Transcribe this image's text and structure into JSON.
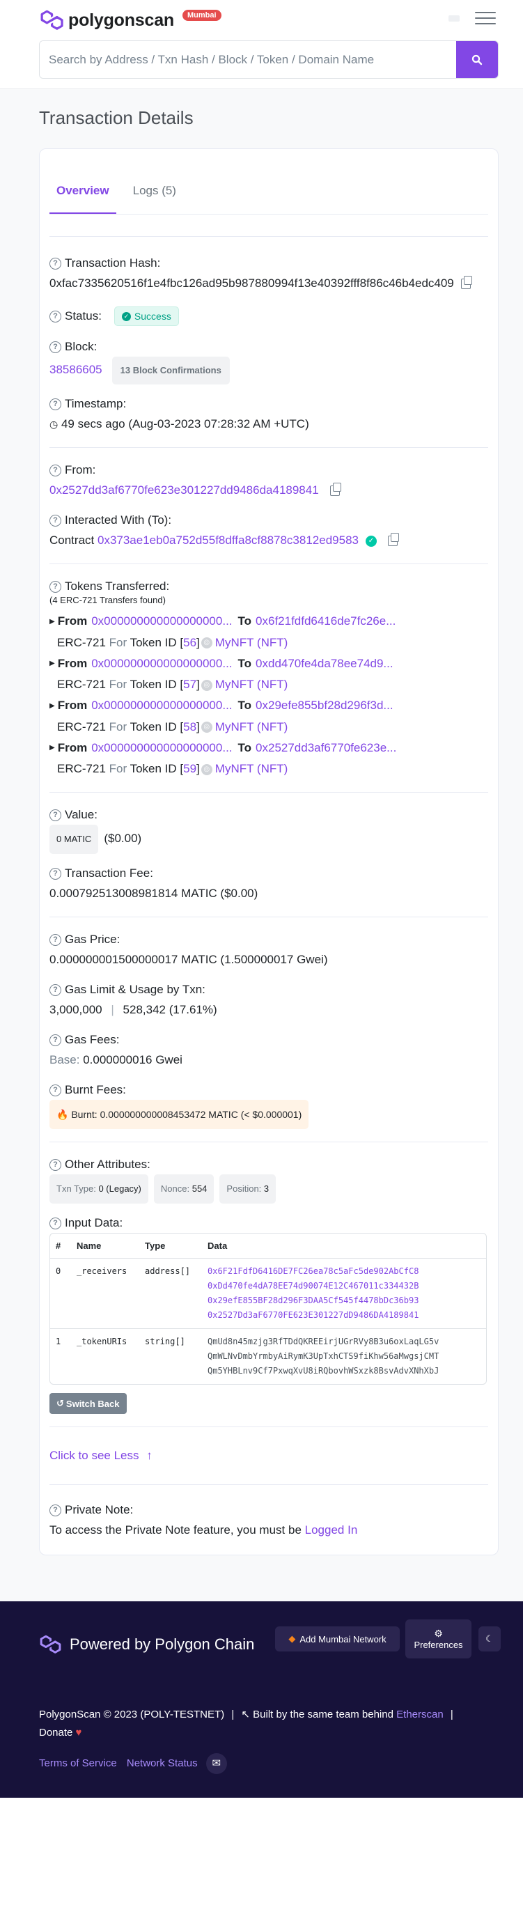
{
  "header": {
    "brand": "polygonscan",
    "network_badge": "Mumbai",
    "search_placeholder": "Search by Address / Txn Hash / Block / Token / Domain Name"
  },
  "page_title": "Transaction Details",
  "tabs": {
    "overview": "Overview",
    "logs": "Logs (5)"
  },
  "tx": {
    "hash_label": "Transaction Hash:",
    "hash": "0xfac7335620516f1e4fbc126ad95b987880994f13e40392fff8f86c46b4edc409",
    "status_label": "Status:",
    "status": "Success",
    "block_label": "Block:",
    "block": "38586605",
    "confirmations": "13 Block Confirmations",
    "timestamp_label": "Timestamp:",
    "timestamp": "49 secs ago (Aug-03-2023 07:28:32 AM +UTC)",
    "from_label": "From:",
    "from": "0x2527dd3af6770fe623e301227dd9486da4189841",
    "to_label": "Interacted With (To):",
    "to_prefix": "Contract",
    "to": "0x373ae1eb0a752d55f8dffa8cf8878c3812ed9583",
    "tokens_label": "Tokens Transferred:",
    "tokens_sub": "(4 ERC-721 Transfers found)",
    "transfers": [
      {
        "from_word": "From",
        "from": "0x000000000000000000...",
        "to_word": "To",
        "to": "0x6f21fdfd6416de7fc26e...",
        "standard": "ERC-721",
        "for_word": "For",
        "token_id_text": "Token ID [",
        "token_id": "56",
        "close": "]",
        "nft": "MyNFT (NFT)"
      },
      {
        "from_word": "From",
        "from": "0x000000000000000000...",
        "to_word": "To",
        "to": "0xdd470fe4da78ee74d9...",
        "standard": "ERC-721",
        "for_word": "For",
        "token_id_text": "Token ID [",
        "token_id": "57",
        "close": "]",
        "nft": "MyNFT (NFT)"
      },
      {
        "from_word": "From",
        "from": "0x000000000000000000...",
        "to_word": "To",
        "to": "0x29efe855bf28d296f3d...",
        "standard": "ERC-721",
        "for_word": "For",
        "token_id_text": "Token ID [",
        "token_id": "58",
        "close": "]",
        "nft": "MyNFT (NFT)"
      },
      {
        "from_word": "From",
        "from": "0x000000000000000000...",
        "to_word": "To",
        "to": "0x2527dd3af6770fe623e...",
        "standard": "ERC-721",
        "for_word": "For",
        "token_id_text": "Token ID [",
        "token_id": "59",
        "close": "]",
        "nft": "MyNFT (NFT)"
      }
    ],
    "value_label": "Value:",
    "value": "0 MATIC",
    "value_usd": "($0.00)",
    "fee_label": "Transaction Fee:",
    "fee": "0.000792513008981814 MATIC ($0.00)",
    "gas_price_label": "Gas Price:",
    "gas_price": "0.000000001500000017 MATIC (1.500000017 Gwei)",
    "gas_limit_label": "Gas Limit & Usage by Txn:",
    "gas_limit": "3,000,000",
    "gas_sep": "|",
    "gas_used": "528,342 (17.61%)",
    "gas_fees_label": "Gas Fees:",
    "gas_fees_base": "Base:",
    "gas_fees": "0.000000016 Gwei",
    "burnt_label": "Burnt Fees:",
    "burnt": "Burnt: 0.000000000008453472 MATIC (< $0.000001)",
    "other_label": "Other Attributes:",
    "txn_type_k": "Txn Type:",
    "txn_type_v": "0 (Legacy)",
    "nonce_k": "Nonce:",
    "nonce_v": "554",
    "position_k": "Position:",
    "position_v": "3",
    "input_label": "Input Data:",
    "input_headers": [
      "#",
      "Name",
      "Type",
      "Data"
    ],
    "input_rows": [
      {
        "idx": "0",
        "name": "_receivers",
        "type": "address[]",
        "data": [
          "0x6F21FdfD6416DE7FC26ea78c5aFc5de902AbCfC8",
          "0xDd470fe4dA78EE74d90074E12C467011c334432B",
          "0x29efE855BF28d296F3DAA5Cf545f4478bDc36b93",
          "0x2527Dd3aF6770FE623E301227dD9486DA4189841"
        ]
      },
      {
        "idx": "1",
        "name": "_tokenURIs",
        "type": "string[]",
        "data": [
          "QmUd8n45mzjg3RfTDdQKREEirjUGrRVy8B3u6oxLaqLG5v",
          "QmWLNvDmbYrmbyAiRymK3UpTxhCTS9fiKhw56aMwgsjCMT",
          "Qm5YHBLnv9Cf7PxwqXvU8iRQbovhWSxzk8BsvAdvXNhXbJ"
        ]
      }
    ],
    "switch_back": "Switch Back",
    "see_less": "Click to see Less",
    "private_label": "Private Note:",
    "private_text": "To access the Private Note feature, you must be",
    "logged_in": "Logged In"
  },
  "footer": {
    "powered": "Powered by Polygon Chain",
    "add_network": "Add Mumbai Network",
    "preferences": "Preferences",
    "copyright": "PolygonScan © 2023 (POLY-TESTNET)",
    "sep": "|",
    "built_by": "Built by the same team behind",
    "etherscan": "Etherscan",
    "donate": "Donate",
    "terms": "Terms of Service",
    "status": "Network Status"
  },
  "colors": {
    "accent": "#8247e5",
    "success": "#00a186",
    "footer_bg": "#17123a"
  }
}
